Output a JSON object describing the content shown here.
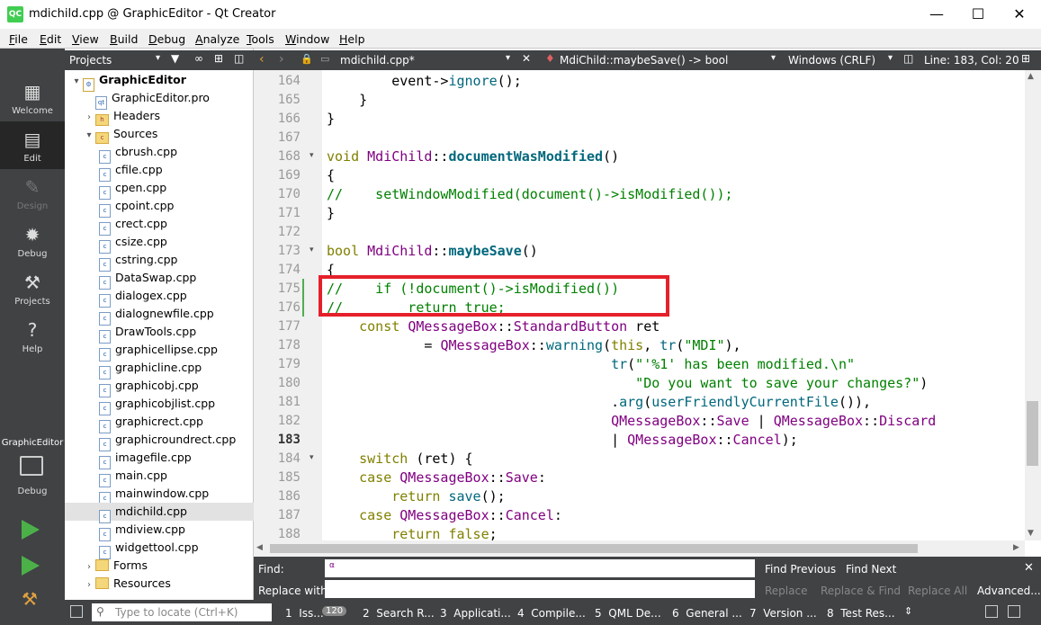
{
  "window": {
    "title": "mdichild.cpp @ GraphicEditor - Qt Creator",
    "icon": "QC"
  },
  "menu": [
    "File",
    "Edit",
    "View",
    "Build",
    "Debug",
    "Analyze",
    "Tools",
    "Window",
    "Help"
  ],
  "modes": [
    {
      "label": "Welcome",
      "icon": "grid-icon"
    },
    {
      "label": "Edit",
      "icon": "document-icon"
    },
    {
      "label": "Design",
      "icon": "pen-icon"
    },
    {
      "label": "Debug",
      "icon": "bug-icon"
    },
    {
      "label": "Projects",
      "icon": "wrench-icon"
    },
    {
      "label": "Help",
      "icon": "question-icon"
    }
  ],
  "kit": {
    "project": "GraphicEditor",
    "label": "Debug"
  },
  "projects": {
    "header": "Projects",
    "tree": [
      {
        "label": "GraphicEditor",
        "level": 0,
        "arrow": "▾",
        "kind": "project",
        "bold": true
      },
      {
        "label": "GraphicEditor.pro",
        "level": 1,
        "arrow": "",
        "kind": "pro"
      },
      {
        "label": "Headers",
        "level": 1,
        "arrow": "›",
        "kind": "folder-h"
      },
      {
        "label": "Sources",
        "level": 1,
        "arrow": "▾",
        "kind": "folder-c"
      },
      {
        "label": "cbrush.cpp",
        "level": 2,
        "arrow": "",
        "kind": "cpp"
      },
      {
        "label": "cfile.cpp",
        "level": 2,
        "arrow": "",
        "kind": "cpp"
      },
      {
        "label": "cpen.cpp",
        "level": 2,
        "arrow": "",
        "kind": "cpp"
      },
      {
        "label": "cpoint.cpp",
        "level": 2,
        "arrow": "",
        "kind": "cpp"
      },
      {
        "label": "crect.cpp",
        "level": 2,
        "arrow": "",
        "kind": "cpp"
      },
      {
        "label": "csize.cpp",
        "level": 2,
        "arrow": "",
        "kind": "cpp"
      },
      {
        "label": "cstring.cpp",
        "level": 2,
        "arrow": "",
        "kind": "cpp"
      },
      {
        "label": "DataSwap.cpp",
        "level": 2,
        "arrow": "",
        "kind": "cpp"
      },
      {
        "label": "dialogex.cpp",
        "level": 2,
        "arrow": "",
        "kind": "cpp"
      },
      {
        "label": "dialognewfile.cpp",
        "level": 2,
        "arrow": "",
        "kind": "cpp"
      },
      {
        "label": "DrawTools.cpp",
        "level": 2,
        "arrow": "",
        "kind": "cpp"
      },
      {
        "label": "graphicellipse.cpp",
        "level": 2,
        "arrow": "",
        "kind": "cpp"
      },
      {
        "label": "graphicline.cpp",
        "level": 2,
        "arrow": "",
        "kind": "cpp"
      },
      {
        "label": "graphicobj.cpp",
        "level": 2,
        "arrow": "",
        "kind": "cpp"
      },
      {
        "label": "graphicobjlist.cpp",
        "level": 2,
        "arrow": "",
        "kind": "cpp"
      },
      {
        "label": "graphicrect.cpp",
        "level": 2,
        "arrow": "",
        "kind": "cpp"
      },
      {
        "label": "graphicroundrect.cpp",
        "level": 2,
        "arrow": "",
        "kind": "cpp"
      },
      {
        "label": "imagefile.cpp",
        "level": 2,
        "arrow": "",
        "kind": "cpp"
      },
      {
        "label": "main.cpp",
        "level": 2,
        "arrow": "",
        "kind": "cpp"
      },
      {
        "label": "mainwindow.cpp",
        "level": 2,
        "arrow": "",
        "kind": "cpp"
      },
      {
        "label": "mdichild.cpp",
        "level": 2,
        "arrow": "",
        "kind": "cpp",
        "selected": true
      },
      {
        "label": "mdiview.cpp",
        "level": 2,
        "arrow": "",
        "kind": "cpp"
      },
      {
        "label": "widgettool.cpp",
        "level": 2,
        "arrow": "",
        "kind": "cpp"
      },
      {
        "label": "Forms",
        "level": 1,
        "arrow": "›",
        "kind": "folder-f"
      },
      {
        "label": "Resources",
        "level": 1,
        "arrow": "›",
        "kind": "folder-r"
      }
    ]
  },
  "editor": {
    "file": "mdichild.cpp*",
    "symbol": "MdiChild::maybeSave() -> bool",
    "encoding": "Windows (CRLF)",
    "position": "Line: 183, Col: 20",
    "current_line": "183",
    "lines": [
      {
        "n": "164",
        "fold": "",
        "html": "        event-><span class='fn'>ignore</span>();"
      },
      {
        "n": "165",
        "fold": "",
        "html": "    }"
      },
      {
        "n": "166",
        "fold": "",
        "html": "}"
      },
      {
        "n": "167",
        "fold": "",
        "html": ""
      },
      {
        "n": "168",
        "fold": "▾",
        "html": "<span class='kw'>void</span> <span class='ty'>MdiChild</span>::<span class='fnb'>documentWasModified</span>()"
      },
      {
        "n": "169",
        "fold": "",
        "html": "{"
      },
      {
        "n": "170",
        "fold": "",
        "html": "<span class='cm'>//    setWindowModified(document()->isModified());</span>"
      },
      {
        "n": "171",
        "fold": "",
        "html": "}"
      },
      {
        "n": "172",
        "fold": "",
        "html": ""
      },
      {
        "n": "173",
        "fold": "▾",
        "html": "<span class='kw'>bool</span> <span class='ty'>MdiChild</span>::<span class='fnb'>maybeSave</span>()"
      },
      {
        "n": "174",
        "fold": "",
        "html": "{"
      },
      {
        "n": "175",
        "fold": "",
        "html": "<span class='cm'>//    if (!document()->isModified())</span>"
      },
      {
        "n": "176",
        "fold": "",
        "html": "<span class='cm'>//        return true;</span>"
      },
      {
        "n": "177",
        "fold": "",
        "html": "    <span class='kw'>const</span> <span class='ty'>QMessageBox</span>::<span class='ty'>StandardButton</span> ret"
      },
      {
        "n": "178",
        "fold": "",
        "html": "            = <span class='ty'>QMessageBox</span>::<span class='fn'>warning</span>(<span class='kw'>this</span>, <span class='fn'>tr</span>(<span class='st'>\"MDI\"</span>),"
      },
      {
        "n": "179",
        "fold": "",
        "html": "                                   <span class='fn'>tr</span>(<span class='st'>\"'%1' has been modified.\\n\"</span>"
      },
      {
        "n": "180",
        "fold": "",
        "html": "                                      <span class='st'>\"Do you want to save your changes?\"</span>)"
      },
      {
        "n": "181",
        "fold": "",
        "html": "                                   .<span class='fn'>arg</span>(<span class='fn'>userFriendlyCurrentFile</span>()),"
      },
      {
        "n": "182",
        "fold": "",
        "html": "                                   <span class='ty'>QMessageBox</span>::<span class='ty'>Save</span> | <span class='ty'>QMessageBox</span>::<span class='ty'>Discard</span>"
      },
      {
        "n": "183",
        "fold": "",
        "html": "                                   | <span class='ty'>QMessageBox</span>::<span class='ty'>Cancel</span>);"
      },
      {
        "n": "184",
        "fold": "▾",
        "html": "    <span class='kw'>switch</span> (ret) {"
      },
      {
        "n": "185",
        "fold": "",
        "html": "    <span class='kw'>case</span> <span class='ty'>QMessageBox</span>::<span class='ty'>Save</span>:"
      },
      {
        "n": "186",
        "fold": "",
        "html": "        <span class='kw'>return</span> <span class='fn'>save</span>();"
      },
      {
        "n": "187",
        "fold": "",
        "html": "    <span class='kw'>case</span> <span class='ty'>QMessageBox</span>::<span class='ty'>Cancel</span>:"
      },
      {
        "n": "188",
        "fold": "",
        "html": "        <span class='kw'>return</span> <span class='kw'>false</span>;"
      }
    ]
  },
  "find": {
    "find_label": "Find:",
    "replace_label": "Replace with:",
    "find_prev": "Find Previous",
    "find_next": "Find Next",
    "replace": "Replace",
    "replace_find": "Replace & Find",
    "replace_all": "Replace All",
    "advanced": "Advanced..."
  },
  "status": {
    "locate_placeholder": "Type to locate (Ctrl+K)",
    "panes": [
      "1  Iss...",
      "2  Search R...",
      "3  Applicati...",
      "4  Compile...",
      "5  QML De...",
      "6  General ...",
      "7  Version ...",
      "8  Test Res..."
    ],
    "issues_count": "120"
  }
}
